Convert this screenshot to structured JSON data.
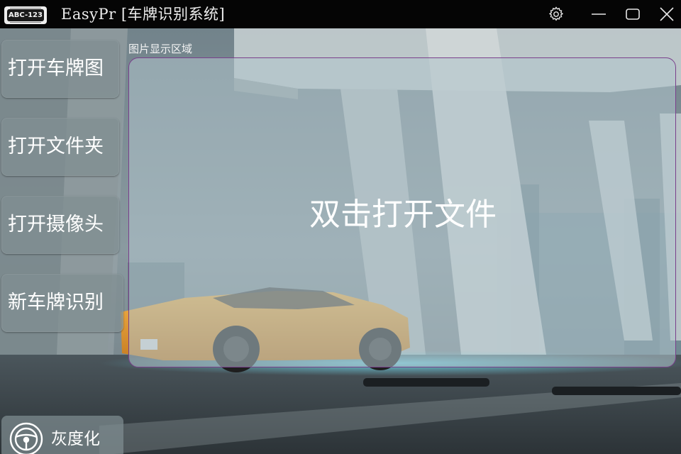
{
  "window": {
    "logo_text": "ABC-123",
    "title": "EasyPr [车牌识别系统]",
    "controls": {
      "settings_icon": "gear-icon",
      "minimize_icon": "minimize-icon",
      "maximize_icon": "maximize-icon",
      "close_icon": "close-icon"
    }
  },
  "sidebar": {
    "buttons": [
      {
        "label": "打开车牌图"
      },
      {
        "label": "打开文件夹"
      },
      {
        "label": "打开摄像头"
      },
      {
        "label": "新车牌识别"
      }
    ],
    "grayscale": {
      "icon": "steering-wheel-icon",
      "label": "灰度化"
    }
  },
  "display": {
    "caption": "图片显示区域",
    "hint": "双击打开文件"
  },
  "colors": {
    "titlebar": "#050505",
    "display_border": "#7a3f8c",
    "car_body": "#e8a33c"
  }
}
